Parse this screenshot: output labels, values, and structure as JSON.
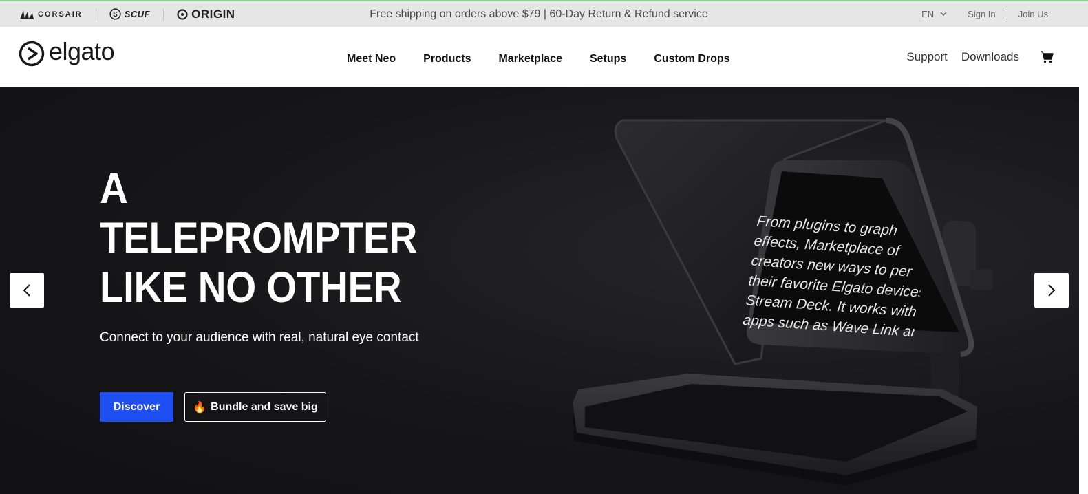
{
  "util_bar": {
    "brands": [
      {
        "name": "CORSAIR",
        "icon": "corsair-sails-icon"
      },
      {
        "name": "SCUF",
        "icon": "scuf-s-icon"
      },
      {
        "name": "ORIGIN",
        "icon": "origin-o-icon"
      }
    ],
    "promo_text": "Free shipping on orders above $79 | 60-Day Return & Refund service",
    "language": "EN",
    "sign_in": "Sign In",
    "join_us": "Join Us"
  },
  "nav": {
    "logo_text": "elgato",
    "links": [
      "Meet Neo",
      "Products",
      "Marketplace",
      "Setups",
      "Custom Drops"
    ],
    "support": "Support",
    "downloads": "Downloads",
    "cart_icon": "cart-icon"
  },
  "hero": {
    "title_lines": [
      "A",
      "TELEPROMPTER",
      "LIKE NO OTHER"
    ],
    "subtitle": "Connect to your audience with real, natural eye contact",
    "primary_cta": "Discover",
    "secondary_cta_icon": "🔥",
    "secondary_cta": "Bundle and save big",
    "screen_text_lines": [
      "From plugins to graph",
      "effects, Marketplace of",
      "creators new ways to per",
      "their favorite Elgato devices",
      "Stream Deck. It works with p",
      "apps such as Wave Link and C"
    ],
    "prev_icon": "chevron-left-icon",
    "next_icon": "chevron-right-icon"
  },
  "colors": {
    "accent_blue": "#1f4ef0",
    "util_bar_bg": "#e6e6e6",
    "hero_bg": "#161618"
  }
}
